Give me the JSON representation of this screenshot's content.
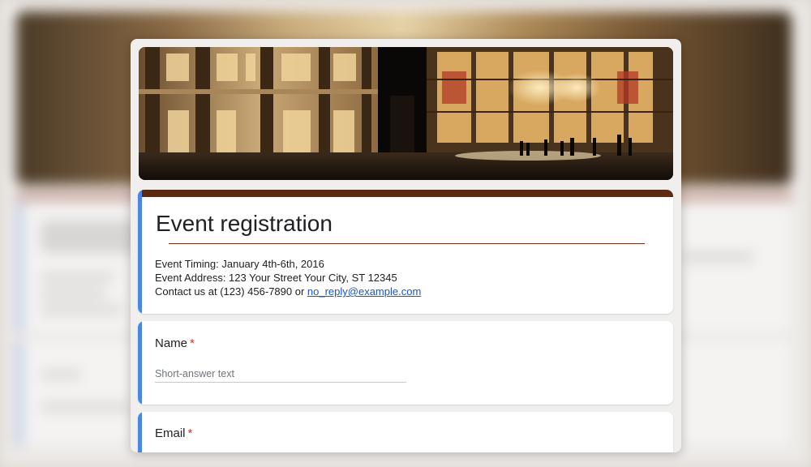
{
  "form": {
    "title": "Event registration",
    "description": {
      "timing": "Event Timing: January 4th-6th, 2016",
      "address": "Event Address: 123 Your Street Your City, ST 12345",
      "contact_prefix": "Contact us at (123) 456-7890 or",
      "contact_email": "no_reply@example.com"
    },
    "questions": [
      {
        "label": "Name",
        "required_mark": "*",
        "placeholder": "Short-answer text"
      },
      {
        "label": "Email",
        "required_mark": "*"
      }
    ],
    "colors": {
      "accent": "#4a86e8",
      "header_strip": "#5a2a14",
      "required": "#d93025",
      "link": "#1a56c8"
    }
  }
}
